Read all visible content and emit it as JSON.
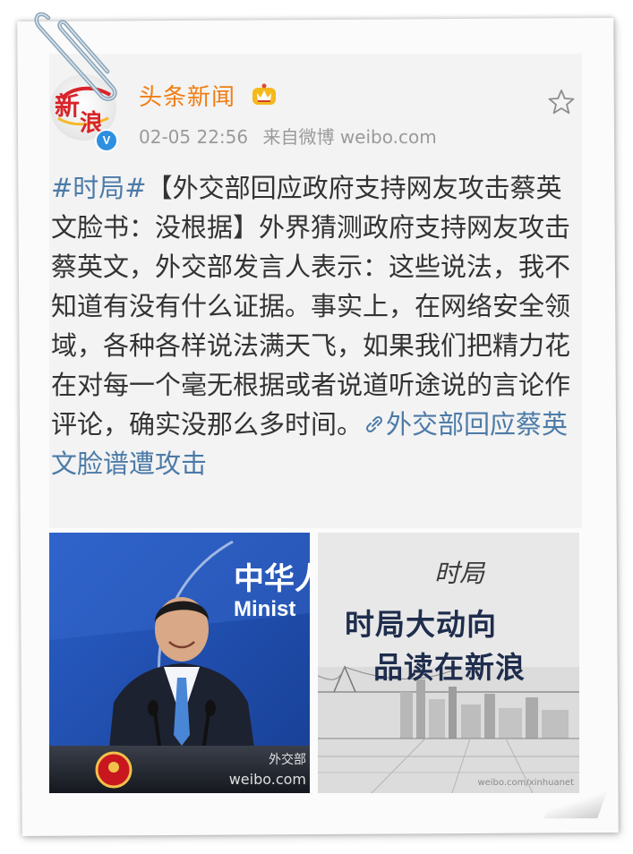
{
  "post": {
    "author": {
      "name": "头条新闻",
      "avatar_text_1": "新",
      "avatar_text_2": "浪",
      "verified_mark": "V"
    },
    "timestamp": "02-05 22:56",
    "source": "来自微博 weibo.com",
    "hashtag": "#时局#",
    "text": "【外交部回应政府支持网友攻击蔡英文脸书：没根据】外界猜测政府支持网友攻击蔡英文，外交部发言人表示：这些说法，我不知道有没有什么证据。事实上，在网络安全领域，各种各样说法满天飞，如果我们把精力花在对每一个毫无根据或者说道听途说的言论作评论，确实没那么多时间。",
    "link_text": "外交部回应蔡英文脸谱遭攻击",
    "icons": [
      "favorite-star-icon",
      "vip-crown-icon",
      "link-icon",
      "paperclip-icon"
    ]
  },
  "images": {
    "left": {
      "banner_text": "中华人",
      "banner_text_en": "Minist",
      "caption": "外交部",
      "watermark": "weibo.com"
    },
    "right": {
      "logo_text": "时局",
      "headline_1": "时局大动向",
      "headline_2": "品读在新浪",
      "watermark": "weibo.com/xinhuanet"
    }
  },
  "colors": {
    "accent_name": "#f07e13",
    "link": "#4c7ba8",
    "text": "#333333",
    "meta": "#9a9a9a"
  }
}
